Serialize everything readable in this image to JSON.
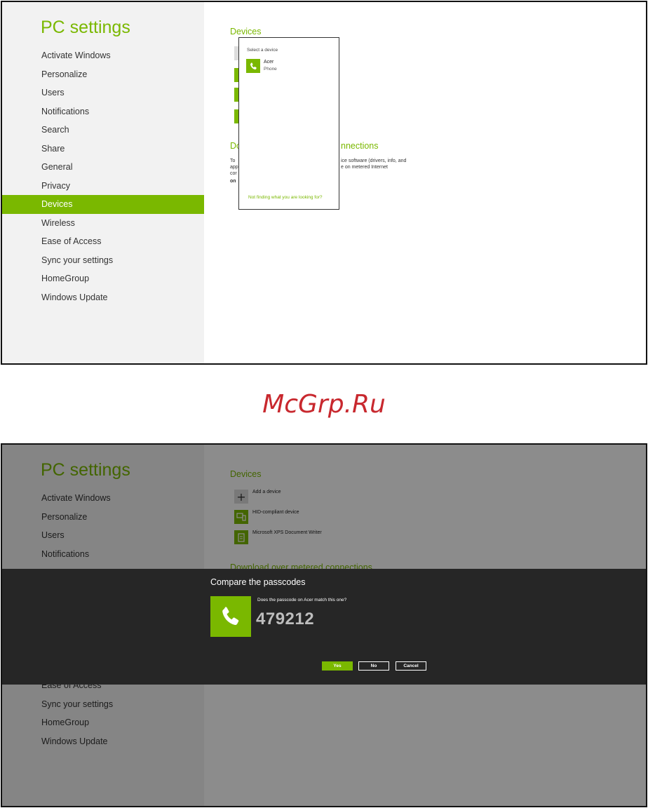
{
  "colors": {
    "accent": "#7ab800",
    "watermark": "#c8282e",
    "dialog_bg": "#262626"
  },
  "shot1": {
    "title": "PC settings",
    "nav": [
      "Activate Windows",
      "Personalize",
      "Users",
      "Notifications",
      "Search",
      "Share",
      "General",
      "Privacy",
      "Devices",
      "Wireless",
      "Ease of Access",
      "Sync your settings",
      "HomeGroup",
      "Windows Update"
    ],
    "active_nav": "Devices",
    "devices_title": "Devices",
    "download_title_start": "Do",
    "download_title_end": "nnections",
    "desc_left": [
      "To",
      "app",
      "cor",
      "on"
    ],
    "desc_right": [
      "ice software (drivers, info, and",
      "e on metered Internet"
    ],
    "popup": {
      "title": "Select a device",
      "item_name": "Acer",
      "item_type": "Phone",
      "item_icon": "phone-icon",
      "link": "Not finding what you are looking for?"
    }
  },
  "watermark": "McGrp.Ru",
  "shot2": {
    "title": "PC settings",
    "nav": [
      "Activate Windows",
      "Personalize",
      "Users",
      "Notifications"
    ],
    "nav_after": [
      "Ease of Access",
      "Sync your settings",
      "HomeGroup",
      "Windows Update"
    ],
    "devices_title": "Devices",
    "devices": [
      {
        "label": "Add a device",
        "icon": "plus-icon"
      },
      {
        "label": "HID-compliant device",
        "icon": "device-icon"
      },
      {
        "label": "Microsoft XPS Document Writer",
        "icon": "printer-icon"
      }
    ],
    "download_title": "Download over metered connections",
    "dialog": {
      "title": "Compare the passcodes",
      "question": "Does the passcode on Acer match this one?",
      "code": "479212",
      "icon": "phone-icon",
      "yes": "Yes",
      "no": "No",
      "cancel": "Cancel"
    }
  }
}
